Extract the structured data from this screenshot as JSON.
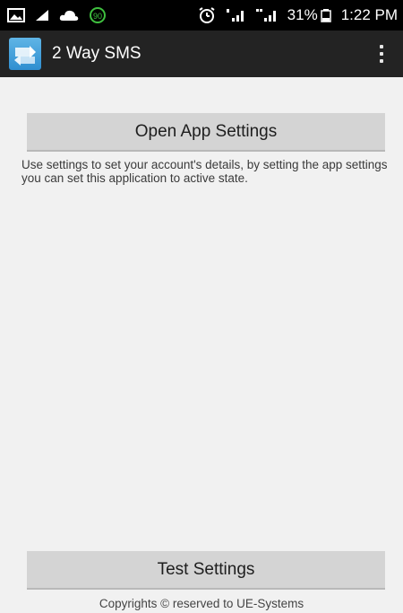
{
  "status_bar": {
    "battery_percent": "31%",
    "time": "1:22 PM",
    "left_icons": [
      "gallery-icon",
      "signal-wedge-icon",
      "cloud-upload-icon",
      "app-notification-icon"
    ],
    "right_icons": [
      "alarm-clock-icon",
      "signal-sim1-icon",
      "signal-sim2-icon",
      "battery-icon"
    ]
  },
  "action_bar": {
    "title": "2 Way SMS",
    "logo_icon": "two-way-arrows-icon",
    "menu_icon": "overflow-menu-icon"
  },
  "main": {
    "open_settings_label": "Open App Settings",
    "description": "Use settings to set your account's details, by setting the app settings you can set this application to active state.",
    "test_settings_label": "Test Settings",
    "footer": "Copyrights © reserved to UE-Systems"
  },
  "colors": {
    "status_bar": "#000000",
    "action_bar": "#232323",
    "background": "#f1f1f1",
    "button": "#d4d4d4",
    "logo": "#3a9ad9"
  }
}
